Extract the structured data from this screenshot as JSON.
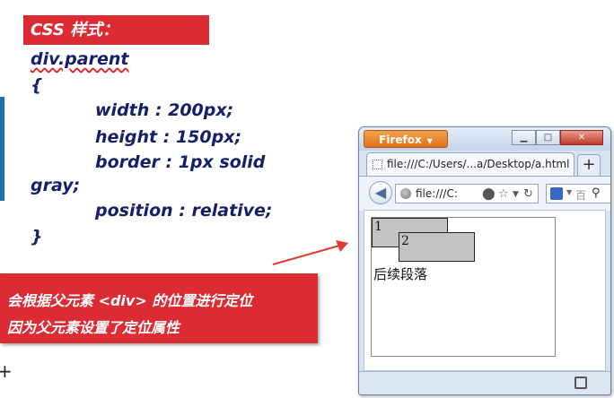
{
  "slide": {
    "header_label": "CSS 样式：",
    "code": {
      "selector": "div.parent",
      "open_brace": "{",
      "width_decl": "width : 200px;",
      "height_decl": "height : 150px;",
      "border_decl_part1": "border : 1px solid",
      "border_decl_part2": "gray;",
      "position_decl": "position : relative;",
      "close_brace": "}"
    },
    "note_line1": "会根据父元素 <div> 的位置进行定位",
    "note_line2": "因为父元素设置了定位属性",
    "plus_mark": "+"
  },
  "browser": {
    "app_button": "Firefox",
    "tab_title": "file:///C:/Users/...a/Desktop/a.html",
    "new_tab": "+",
    "url": "file:///C:",
    "search_placeholder": "百",
    "page": {
      "box1_label": "1",
      "box2_label": "2",
      "paragraph": "后续段落"
    }
  },
  "colors": {
    "accent_red": "#dc2b32",
    "code_blue": "#15206b",
    "firefox_orange": "#e0711c"
  }
}
